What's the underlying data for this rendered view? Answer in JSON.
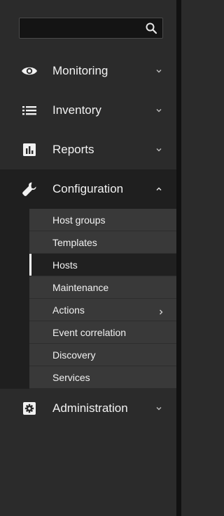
{
  "search": {
    "placeholder": "",
    "value": ""
  },
  "menu": {
    "items": [
      {
        "label": "Monitoring",
        "icon": "eye-icon",
        "expanded": false
      },
      {
        "label": "Inventory",
        "icon": "list-icon",
        "expanded": false
      },
      {
        "label": "Reports",
        "icon": "bar-chart-icon",
        "expanded": false
      },
      {
        "label": "Configuration",
        "icon": "wrench-icon",
        "expanded": true
      },
      {
        "label": "Administration",
        "icon": "gear-icon",
        "expanded": false
      }
    ],
    "configuration_submenu": [
      {
        "label": "Host groups"
      },
      {
        "label": "Templates"
      },
      {
        "label": "Hosts",
        "selected": true
      },
      {
        "label": "Maintenance"
      },
      {
        "label": "Actions",
        "has_submenu": true
      },
      {
        "label": "Event correlation"
      },
      {
        "label": "Discovery"
      },
      {
        "label": "Services"
      }
    ]
  },
  "colors": {
    "sidebar_bg": "#2b2b2b",
    "submenu_bg": "#393939",
    "selected_bg": "#202020",
    "text": "#f2f2f2",
    "active_indicator": "#ffffff"
  }
}
